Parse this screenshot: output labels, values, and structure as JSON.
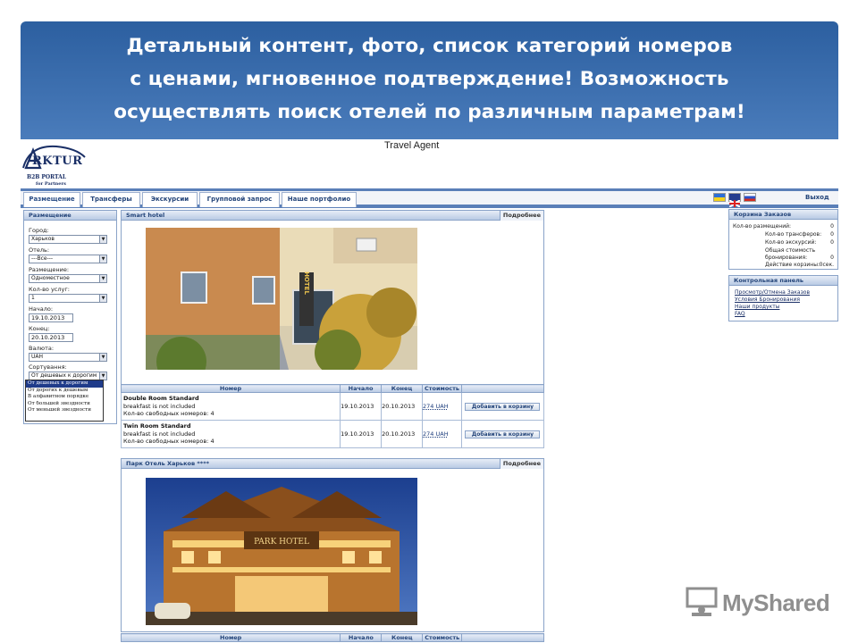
{
  "banner": {
    "line1": "Детальный контент, фото, список категорий номеров",
    "line2": "с ценами, мгновенное подтверждение! Возможность",
    "line3": "осуществлять поиск отелей по различным параметрам!"
  },
  "app": {
    "title": "Travel Agent",
    "logo_text": "RKTUR",
    "logo_line2": "B2B PORTAL",
    "logo_line3": "for Partners",
    "exit_label": "Выход"
  },
  "nav": {
    "tabs": [
      "Размещение",
      "Трансферы",
      "Экскурсии",
      "Групповой запрос",
      "Наше портфолио"
    ]
  },
  "search": {
    "header": "Размещение",
    "city_label": "Город:",
    "city_value": "Харьков",
    "hotel_label": "Отель:",
    "hotel_value": "---Все---",
    "placement_label": "Размещение:",
    "placement_value": "Одноместное",
    "services_label": "Кол-во услуг:",
    "services_value": "1",
    "start_label": "Начало:",
    "start_value": "19.10.2013",
    "end_label": "Конец:",
    "end_value": "20.10.2013",
    "currency_label": "Валюта:",
    "currency_value": "UAH",
    "sort_label": "Сортування:",
    "sort_value": "От дешевых к дорогим",
    "sort_options": [
      "От дешевых к дорогим",
      "От дорогих к дешевым",
      "В алфавитном порядке",
      "От большей звездности",
      "От меньшей звездности"
    ]
  },
  "hotels": [
    {
      "name": "Smart hotel",
      "more": "Подробнее",
      "sign_text": "HOTEL",
      "columns": [
        "Номер",
        "Начало",
        "Конец",
        "Стоимость"
      ],
      "rooms": [
        {
          "name": "Double Room Standard",
          "note": "breakfast is not included",
          "avail": "Кол-во свободных номеров: 4",
          "start": "19.10.2013",
          "end": "20.10.2013",
          "price": "274 UAH",
          "add": "Добавить в корзину"
        },
        {
          "name": "Twin Room Standard",
          "note": "breakfast is not included",
          "avail": "Кол-во свободных номеров: 4",
          "start": "19.10.2013",
          "end": "20.10.2013",
          "price": "274 UAH",
          "add": "Добавить в корзину"
        }
      ]
    },
    {
      "name": "Парк Отель Харьков ****",
      "more": "Подробнее",
      "sign_text": "PARK HOTEL",
      "columns": [
        "Номер",
        "Начало",
        "Конец",
        "Стоимость"
      ]
    }
  ],
  "cart": {
    "header": "Корзина Заказов",
    "rows": [
      {
        "label": "Кол-во размещений:",
        "value": "0"
      },
      {
        "label": "Кол-во трансферов:",
        "value": "0"
      },
      {
        "label": "Кол-во экскурсий:",
        "value": "0"
      },
      {
        "label": "Общая стоимость",
        "value": ""
      },
      {
        "label": "бронирования:",
        "value": "0"
      },
      {
        "label": "Действие корзины:",
        "value": "0сек."
      }
    ]
  },
  "control": {
    "header": "Контрольная панель",
    "links": [
      "Просмотр/Отмена Заказов",
      "Условия Бронирования",
      "Наши продукты",
      "FAQ"
    ]
  },
  "watermark": {
    "text": "MyShared"
  },
  "colors": {
    "banner": "#3a6aab",
    "nav_border": "#5a7fb8",
    "header_text": "#24457a",
    "highlight": "#1f3b8a"
  }
}
